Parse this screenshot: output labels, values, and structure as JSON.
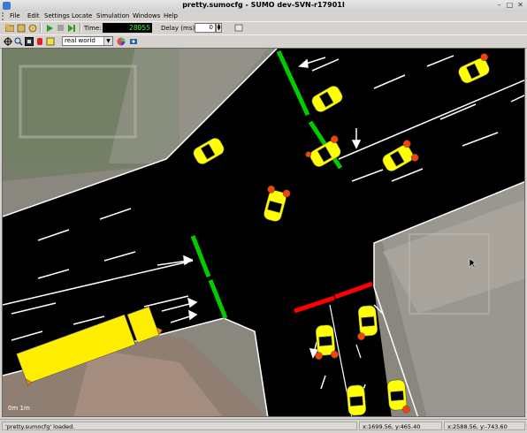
{
  "window": {
    "title": "pretty.sumocfg - SUMO dev-SVN-r17901I"
  },
  "menu": [
    "File",
    "Edit",
    "Settings",
    "Locate",
    "Simulation",
    "Windows",
    "Help"
  ],
  "toolbar": {
    "time_label": "Time:",
    "time_value": "28055",
    "delay_label": "Delay (ms):",
    "delay_value": "0"
  },
  "view": {
    "scheme": "real world",
    "scale_label": "0m   1m"
  },
  "status": {
    "message": "'pretty.sumocfg' loaded.",
    "coords_1": "x:1699.56, y:465.40",
    "coords_2": "x:2588.56, y:-743.60"
  },
  "colors": {
    "road": "#000000",
    "lane_marking": "#ffffff",
    "signal_green": "#00cc00",
    "signal_red": "#ff0000",
    "vehicle": "#ffff00",
    "truck": "#ffee00",
    "brake_light": "#ff4000"
  }
}
